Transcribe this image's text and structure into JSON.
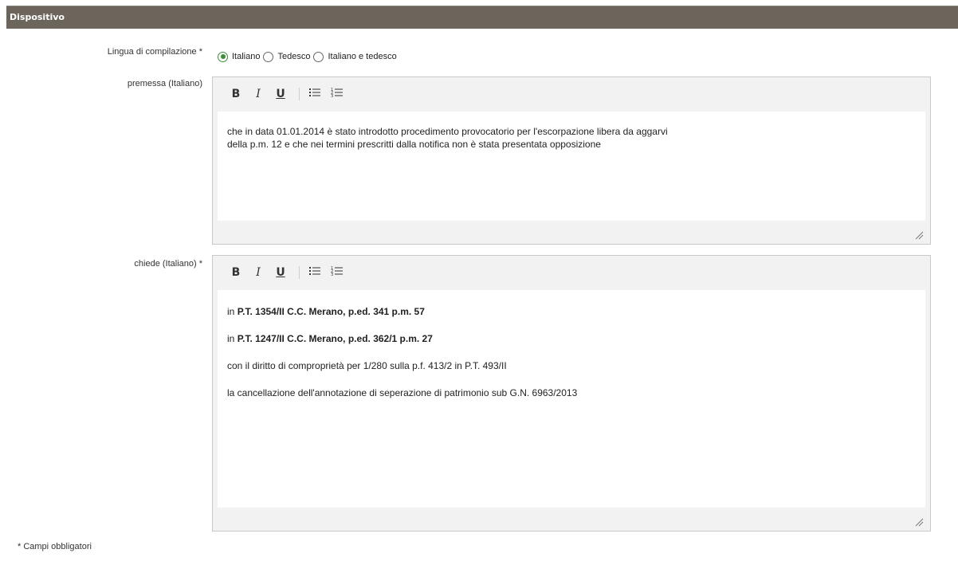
{
  "section": {
    "title": "Dispositivo"
  },
  "lingua": {
    "label": "Lingua di compilazione *",
    "options": [
      "Italiano",
      "Tedesco",
      "Italiano e tedesco"
    ],
    "selected": "Italiano"
  },
  "premessa": {
    "label": "premessa (Italiano)",
    "lines": [
      "che in data 01.01.2014 è stato introdotto procedimento provocatorio per l'escorpazione libera da aggarvi",
      "della p.m. 12 e che nei termini prescritti dalla notifica non è stata presentata opposizione"
    ]
  },
  "chiede": {
    "label": "chiede (Italiano) *",
    "p1_prefix": "in ",
    "p1_bold": "P.T. 1354/II C.C. Merano, p.ed. 341 p.m. 57",
    "p2_prefix": "in ",
    "p2_bold": "P.T. 1247/II C.C. Merano, p.ed. 362/1 p.m. 27",
    "p3": "con il diritto di comproprietà per 1/280 sulla p.f. 413/2 in P.T. 493/II",
    "p4": "la cancellazione dell'annotazione di seperazione di patrimonio sub G.N. 6963/2013"
  },
  "toolbar": {
    "bold": "B",
    "italic": "I",
    "underline": "U",
    "bullet": "☰",
    "numbered": "☷"
  },
  "footnote": "* Campi obbligatori"
}
